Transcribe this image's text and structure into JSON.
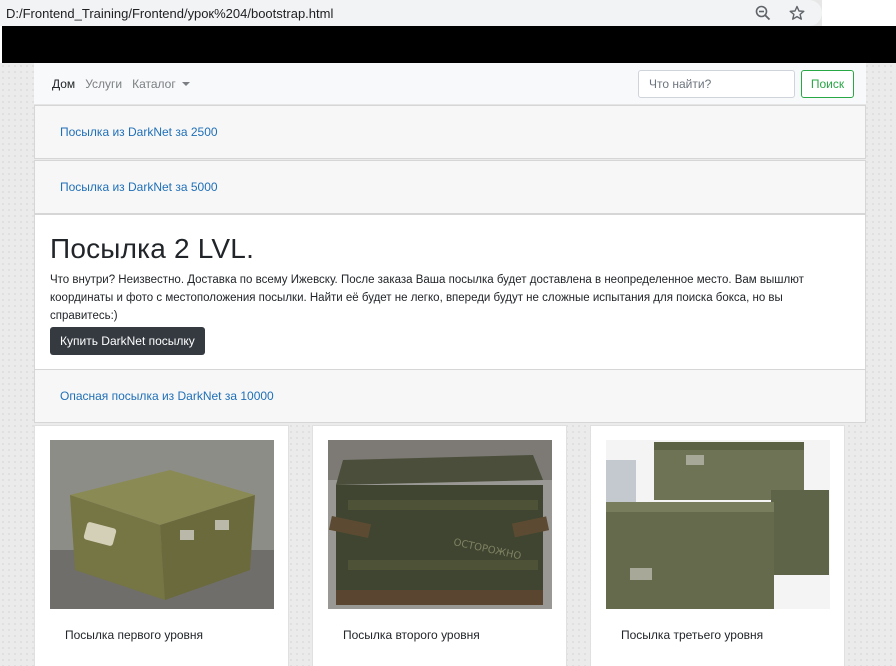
{
  "browser": {
    "url": "D:/Frontend_Training/Frontend/урок%204/bootstrap.html",
    "zoom_icon": "zoom-out-icon",
    "star_icon": "star-icon"
  },
  "navbar": {
    "links": [
      {
        "label": "Дом",
        "active": true
      },
      {
        "label": "Услуги",
        "active": false
      },
      {
        "label": "Каталог",
        "active": false
      }
    ],
    "search_placeholder": "Что найти?",
    "search_button": "Поиск"
  },
  "offers": [
    {
      "label": "Посылка из DarkNet за 2500"
    },
    {
      "label": "Посылка из DarkNet за 5000"
    }
  ],
  "jumbotron": {
    "title": "Посылка 2 LVL.",
    "text": "Что внутри? Неизвестно. Доставка по всему Ижевску. После заказа Ваша посылка будет доставлена в неопределенное место. Вам вышлют координаты и фото с местоположения посылки. Найти её будет не легко, впереди будут не сложные испытания для поиска бокса, но вы справитесь:)",
    "button": "Купить DarkNet посылку"
  },
  "danger_offer": {
    "label": "Опасная посылка из DarkNet за 10000"
  },
  "products": [
    {
      "title": "Посылка первого уровня"
    },
    {
      "title": "Посылка второго уровня"
    },
    {
      "title": "Посылка третьего уровня"
    }
  ],
  "colors": {
    "link": "#1f6fb8",
    "success": "#28a745",
    "dark_button": "#343a40"
  }
}
